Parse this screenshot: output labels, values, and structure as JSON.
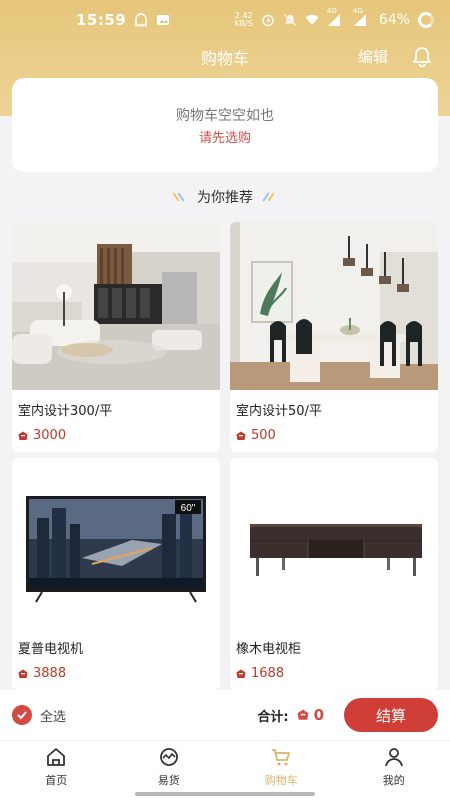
{
  "status_bar": {
    "time": "15:59",
    "net_speed_value": "2.42",
    "net_speed_unit": "KB/S",
    "battery": "64%",
    "sim1": "4G",
    "sim2": "4G"
  },
  "nav": {
    "title": "购物车",
    "edit_label": "编辑",
    "bell_icon": "bell-icon"
  },
  "cart": {
    "empty_text": "购物车空空如也",
    "empty_link": "请先选购"
  },
  "recommend": {
    "title": "为你推荐"
  },
  "products": [
    {
      "title": "室内设计300/平",
      "price": "3000",
      "image": "living-room-image"
    },
    {
      "title": "室内设计50/平",
      "price": "500",
      "image": "dining-room-image"
    },
    {
      "title": "夏普电视机",
      "price": "3888",
      "image": "tv-image",
      "badge": "60\""
    },
    {
      "title": "橡木电视柜",
      "price": "1688",
      "image": "tv-cabinet-image"
    }
  ],
  "checkout": {
    "select_all": "全选",
    "total_label": "合计:",
    "total_value": "0",
    "pay_label": "结算"
  },
  "tabs": [
    {
      "label": "首页",
      "icon": "home-icon",
      "active": false
    },
    {
      "label": "易货",
      "icon": "exchange-icon",
      "active": false
    },
    {
      "label": "购物车",
      "icon": "cart-icon",
      "active": true
    },
    {
      "label": "我的",
      "icon": "user-icon",
      "active": false
    }
  ],
  "colors": {
    "header": "#e6c67a",
    "accent_red": "#cf3f38",
    "active_tab": "#d9b36a",
    "background": "#f3f2f4"
  }
}
